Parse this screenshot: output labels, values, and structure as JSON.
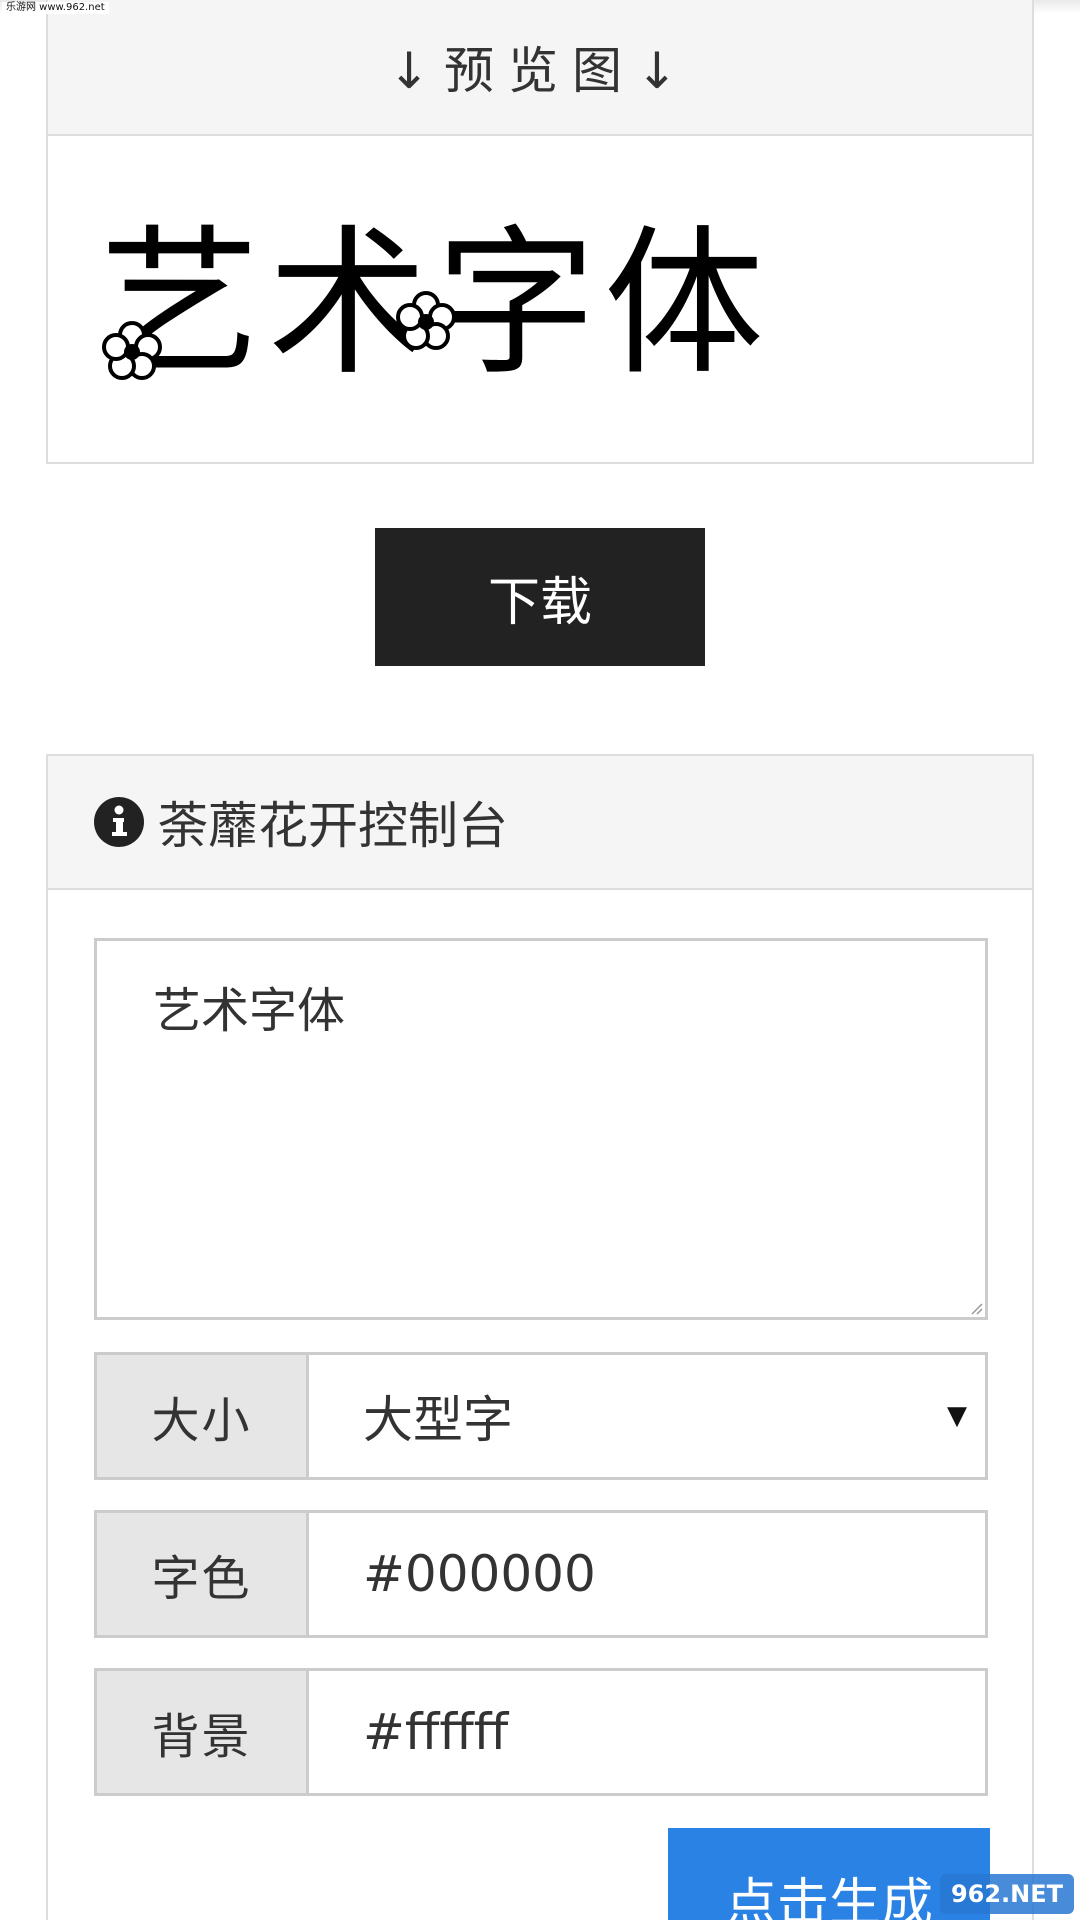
{
  "watermark_top": "乐游网 www.962.net",
  "preview": {
    "title": "↓预览图↓",
    "art_text": "艺术字体"
  },
  "download_label": "下载",
  "console": {
    "title": "荼蘼花开控制台",
    "icon": "info-circle-icon",
    "text_value": "艺术字体",
    "size": {
      "label": "大小",
      "value": "大型字"
    },
    "font_color": {
      "label": "字色",
      "value": "#000000"
    },
    "background": {
      "label": "背景",
      "value": "#ffffff"
    },
    "generate_label": "点击生成"
  },
  "watermark_logo": "962.NET",
  "colors": {
    "download_bg": "#222222",
    "generate_bg": "#2a82e4",
    "panel_header_bg": "#f5f5f5",
    "label_bg": "#e6e6e6"
  }
}
